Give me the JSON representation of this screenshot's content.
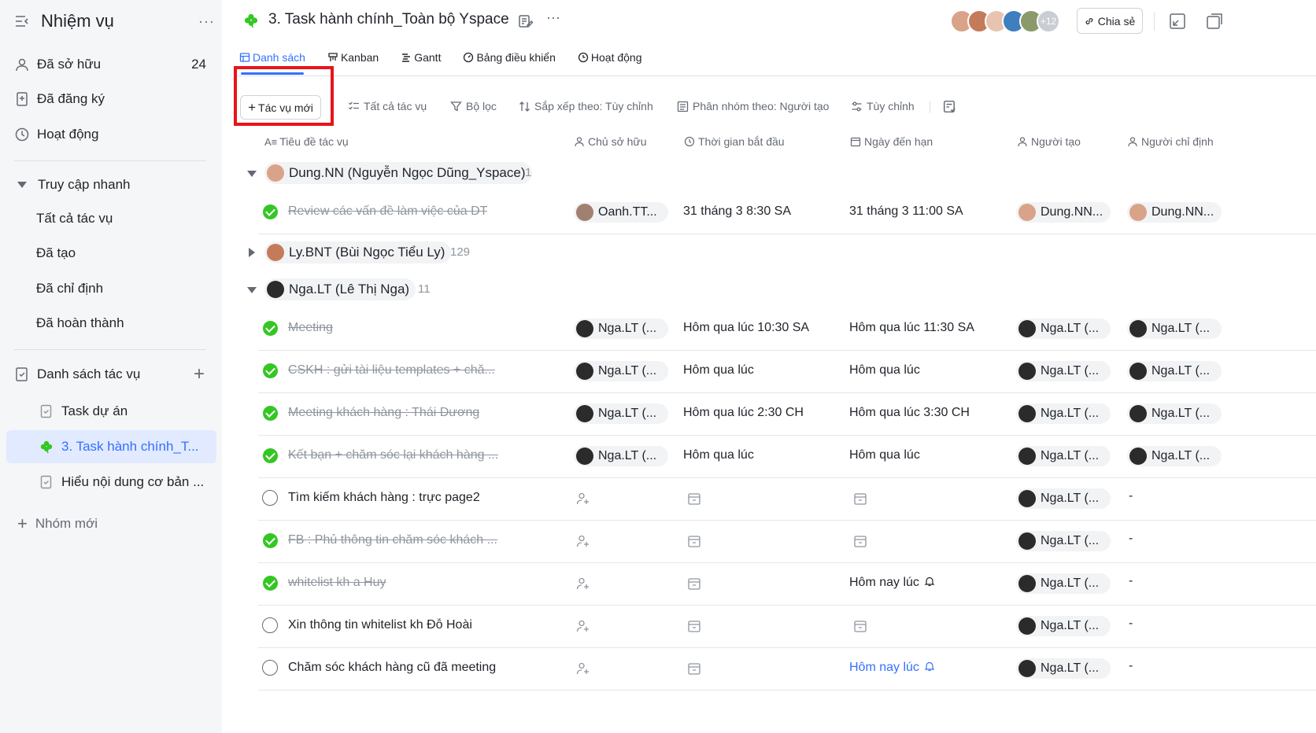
{
  "sidebar": {
    "title": "Nhiệm vụ",
    "more": "···",
    "owned": {
      "label": "Đã sở hữu",
      "count": "24"
    },
    "subscribed": {
      "label": "Đã đăng ký"
    },
    "activity": {
      "label": "Hoạt động"
    },
    "quick_access": {
      "label": "Truy cập nhanh"
    },
    "quick_items": [
      "Tất cả tác vụ",
      "Đã tạo",
      "Đã chỉ định",
      "Đã hoàn thành"
    ],
    "task_lists": {
      "label": "Danh sách tác vụ"
    },
    "lists": [
      "Task dự án",
      "3. Task hành chính_T...",
      "Hiểu nội dung cơ bản ..."
    ],
    "new_group": "Nhóm mới"
  },
  "topbar": {
    "title": "3. Task hành chính_Toàn bộ Yspace",
    "more": "···",
    "avatar_more": "+12",
    "share": "Chia sẻ",
    "avatar_colors": [
      "#d9a38a",
      "#c47b5a",
      "#e8c4b0",
      "#3f7fbf",
      "#8a9a6a"
    ]
  },
  "tabs": [
    {
      "label": "Danh sách",
      "icon": "list-icon"
    },
    {
      "label": "Kanban",
      "icon": "kanban-icon"
    },
    {
      "label": "Gantt",
      "icon": "gantt-icon"
    },
    {
      "label": "Bảng điều khiển",
      "icon": "dashboard-icon"
    },
    {
      "label": "Hoạt động",
      "icon": "activity-icon"
    }
  ],
  "toolbar": {
    "new_task": "Tác vụ mới",
    "all_tasks": "Tất cả tác vụ",
    "filter": "Bộ lọc",
    "sort": "Sắp xếp theo: Tùy chỉnh",
    "group": "Phân nhóm theo: Người tạo",
    "customize": "Tùy chỉnh"
  },
  "columns": {
    "title": "Tiêu đề tác vụ",
    "owner": "Chủ sở hữu",
    "start": "Thời gian bắt đầu",
    "due": "Ngày đến hạn",
    "creator": "Người tạo",
    "assigner": "Người chỉ định"
  },
  "groups": [
    {
      "name": "Dung.NN (Nguyễn Ngọc Dũng_Yspace)",
      "count": "1"
    },
    {
      "name": "Ly.BNT (Bùi Ngọc Tiểu Ly)",
      "count": "129"
    },
    {
      "name": "Nga.LT (Lê Thị Nga)",
      "count": "11"
    }
  ],
  "tasks": [
    {
      "title": "Review các vấn đề làm việc của DT",
      "done": true,
      "owner": "Oanh.TT...",
      "start": "31 tháng 3 8:30 SA",
      "due": "31 tháng 3 11:00 SA",
      "creator": "Dung.NN...",
      "assigner": "Dung.NN..."
    },
    {
      "title": "Meeting",
      "done": true,
      "owner": "Nga.LT (...",
      "start": "Hôm qua lúc 10:30 SA",
      "due": "Hôm qua lúc 11:30 SA",
      "creator": "Nga.LT (...",
      "assigner": "Nga.LT (..."
    },
    {
      "title": "CSKH : gửi tài liệu templates + chă...",
      "done": true,
      "owner": "Nga.LT (...",
      "start": "Hôm qua lúc",
      "due": "Hôm qua lúc",
      "creator": "Nga.LT (...",
      "assigner": "Nga.LT (..."
    },
    {
      "title": "Meeting khách hàng : Thái Dương",
      "done": true,
      "owner": "Nga.LT (...",
      "start": "Hôm qua lúc 2:30 CH",
      "due": "Hôm qua lúc 3:30 CH",
      "creator": "Nga.LT (...",
      "assigner": "Nga.LT (..."
    },
    {
      "title": "Kết bạn + chăm sóc lại khách hàng ...",
      "done": true,
      "owner": "Nga.LT (...",
      "start": "Hôm qua lúc",
      "due": "Hôm qua lúc",
      "creator": "Nga.LT (...",
      "assigner": "Nga.LT (..."
    },
    {
      "title": "Tìm kiếm khách hàng : trực page2",
      "done": false,
      "creator": "Nga.LT (...",
      "assigner": "-"
    },
    {
      "title": "FB : Phủ thông tin chăm sóc khách ...",
      "done": true,
      "creator": "Nga.LT (...",
      "assigner": "-"
    },
    {
      "title": "whitelist kh a Huy",
      "done": true,
      "due": "Hôm nay lúc",
      "creator": "Nga.LT (...",
      "assigner": "-"
    },
    {
      "title": "Xin thông tin whitelist kh Đỗ Hoài",
      "done": false,
      "creator": "Nga.LT (...",
      "assigner": "-"
    },
    {
      "title": "Chăm sóc khách hàng cũ đã meeting",
      "done": false,
      "due": "Hôm nay lúc",
      "creator": "Nga.LT (...",
      "assigner": "-"
    }
  ],
  "colors": {
    "accent": "#3370ff",
    "done": "#34c724",
    "highlight": "#e8141b",
    "active_bg": "#e1eaff"
  }
}
